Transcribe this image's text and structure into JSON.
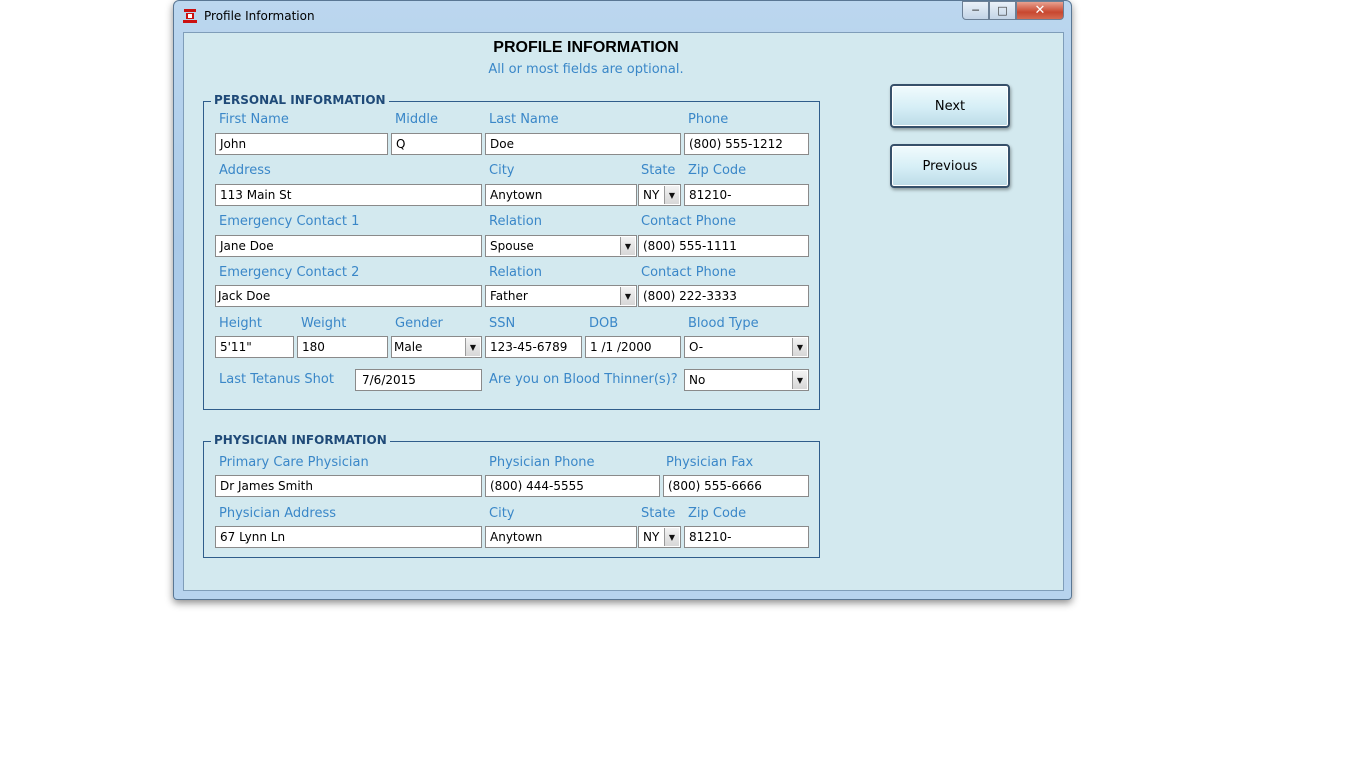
{
  "window": {
    "title": "Profile Information",
    "minimize_glyph": "─",
    "maximize_glyph": "□",
    "close_glyph": "✕"
  },
  "header": {
    "title": "PROFILE INFORMATION",
    "subtitle": "All or most fields are optional."
  },
  "buttons": {
    "next": "Next",
    "previous": "Previous"
  },
  "personal": {
    "group_label": "PERSONAL INFORMATION",
    "first_name": {
      "label": "First Name",
      "value": "John"
    },
    "middle": {
      "label": "Middle",
      "value": "Q"
    },
    "last_name": {
      "label": "Last Name",
      "value": "Doe"
    },
    "phone": {
      "label": "Phone",
      "value": "(800) 555-1212"
    },
    "address": {
      "label": "Address",
      "value": "113 Main St"
    },
    "city": {
      "label": "City",
      "value": "Anytown"
    },
    "state": {
      "label": "State",
      "value": "NY"
    },
    "zip": {
      "label": "Zip Code",
      "value": "81210-"
    },
    "emergency1": {
      "label": "Emergency Contact 1",
      "value": "Jane Doe"
    },
    "relation1": {
      "label": "Relation",
      "value": "Spouse"
    },
    "contact_phone1": {
      "label": "Contact Phone",
      "value": "(800) 555-1111"
    },
    "emergency2": {
      "label": "Emergency Contact 2",
      "value": "Jack Doe"
    },
    "relation2": {
      "label": "Relation",
      "value": "Father"
    },
    "contact_phone2": {
      "label": "Contact Phone",
      "value": "(800) 222-3333"
    },
    "height": {
      "label": "Height",
      "value": "5'11\""
    },
    "weight": {
      "label": "Weight",
      "value": "180"
    },
    "gender": {
      "label": "Gender",
      "value": "Male"
    },
    "ssn": {
      "label": "SSN",
      "value": "123-45-6789"
    },
    "dob": {
      "label": "DOB",
      "value": "1 /1 /2000"
    },
    "blood_type": {
      "label": "Blood Type",
      "value": "O-"
    },
    "tetanus": {
      "label": "Last Tetanus Shot",
      "value": "7/6/2015"
    },
    "thinners": {
      "label": "Are you on Blood Thinner(s)?",
      "value": "No"
    }
  },
  "physician": {
    "group_label": "PHYSICIAN INFORMATION",
    "primary": {
      "label": "Primary Care Physician",
      "value": "Dr James Smith"
    },
    "phone": {
      "label": "Physician Phone",
      "value": "(800) 444-5555"
    },
    "fax": {
      "label": "Physician Fax",
      "value": "(800) 555-6666"
    },
    "address": {
      "label": "Physician Address",
      "value": "67 Lynn Ln"
    },
    "city": {
      "label": "City",
      "value": "Anytown"
    },
    "state": {
      "label": "State",
      "value": "NY"
    },
    "zip": {
      "label": "Zip Code",
      "value": "81210-"
    }
  },
  "colors": {
    "label_blue": "#3a87c8",
    "group_border": "#2f5d8b",
    "client_bg": "#d3e9ef"
  },
  "icons": {
    "app": "app-logo-icon",
    "dropdown": "chevron-down-icon"
  }
}
